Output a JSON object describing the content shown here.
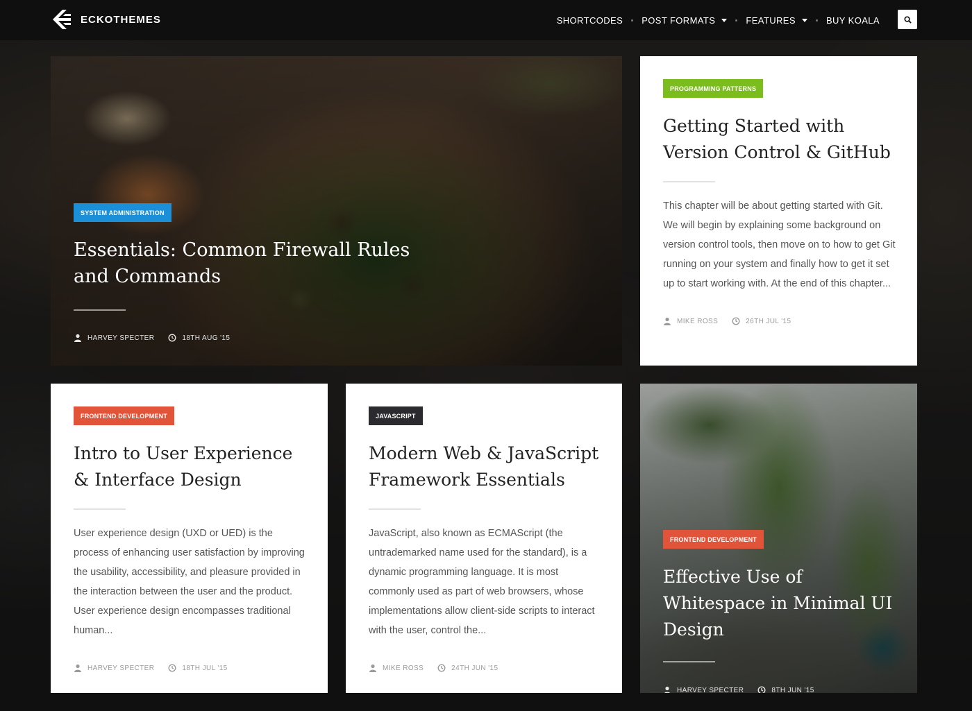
{
  "brand": {
    "name": "ECKOTHEMES",
    "logo_icon": "eckothemes-logo-icon"
  },
  "nav": {
    "items": [
      {
        "label": "SHORTCODES",
        "has_dropdown": false
      },
      {
        "label": "POST FORMATS",
        "has_dropdown": true
      },
      {
        "label": "FEATURES",
        "has_dropdown": true
      },
      {
        "label": "BUY KOALA",
        "has_dropdown": false
      }
    ],
    "search_icon": "search-icon"
  },
  "colors": {
    "system_administration": "#1b8fd8",
    "programming_patterns": "#7cbd1e",
    "frontend_development": "#e2543a",
    "javascript": "#2b2b2f"
  },
  "posts": [
    {
      "category": "SYSTEM ADMINISTRATION",
      "title": "Essentials: Common Firewall Rules and Commands",
      "author": "HARVEY SPECTER",
      "date": "18TH AUG '15"
    },
    {
      "category": "PROGRAMMING PATTERNS",
      "title": "Getting Started with Version Control & GitHub",
      "excerpt": "This chapter will be about getting started with Git. We will begin by explaining some background on version control tools, then move on to how to get Git running on your system and finally how to get it set up to start working with. At the end of this chapter...",
      "author": "MIKE ROSS",
      "date": "26TH JUL '15"
    },
    {
      "category": "FRONTEND DEVELOPMENT",
      "title": "Intro to User Experience & Interface Design",
      "excerpt": "User experience design (UXD or UED) is the process of enhancing user satisfaction by improving the usability, accessibility, and pleasure provided in the interaction between the user and the product. User experience design encompasses traditional human...",
      "author": "HARVEY SPECTER",
      "date": "18TH JUL '15"
    },
    {
      "category": "JAVASCRIPT",
      "title": "Modern Web & JavaScript Framework Essentials",
      "excerpt": "JavaScript, also known as ECMAScript (the untrademarked name used for the standard), is a dynamic programming language. It is most commonly used as part of web browsers, whose implementations allow client-side scripts to interact with the user, control the...",
      "author": "MIKE ROSS",
      "date": "24TH JUN '15"
    },
    {
      "category": "FRONTEND DEVELOPMENT",
      "title": "Effective Use of Whitespace in Minimal UI Design",
      "author": "HARVEY SPECTER",
      "date": "8TH JUN '15"
    }
  ],
  "meta_icons": {
    "author": "user-icon",
    "date": "clock-icon"
  }
}
